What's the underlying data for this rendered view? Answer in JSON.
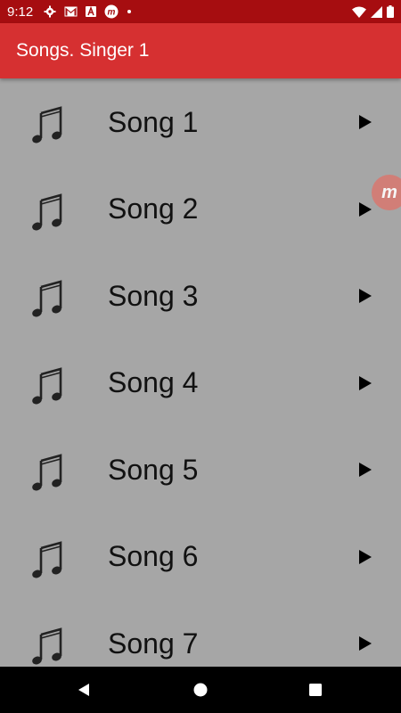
{
  "status_bar": {
    "time": "9:12",
    "icons": [
      "gear-icon",
      "gmail-icon",
      "font-icon",
      "m-icon",
      "dot-icon",
      "wifi-icon",
      "signal-icon",
      "battery-icon"
    ]
  },
  "app_bar": {
    "title": "Songs. Singer 1",
    "color": "#d63031",
    "status_color": "#a60d10"
  },
  "songs": [
    {
      "title": "Song 1"
    },
    {
      "title": "Song 2"
    },
    {
      "title": "Song 3"
    },
    {
      "title": "Song 4"
    },
    {
      "title": "Song 5"
    },
    {
      "title": "Song 6"
    },
    {
      "title": "Song 7"
    }
  ],
  "list_background": "#a6a6a6",
  "floating_bubble": {
    "letter": "m"
  },
  "nav_bar": {
    "buttons": [
      "back-icon",
      "home-icon",
      "recents-icon"
    ]
  }
}
